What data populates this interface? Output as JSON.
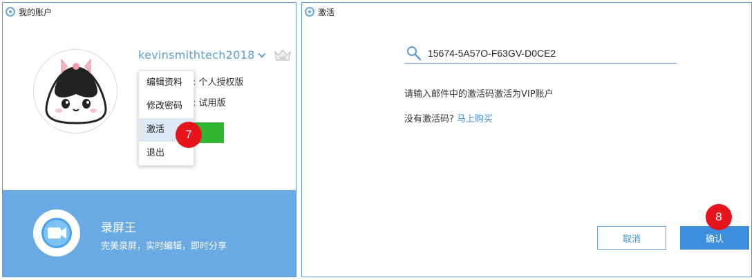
{
  "account_window": {
    "title": "我的账户",
    "username": "kevinsmithtech2018",
    "crown_icon": "vip-crown-icon",
    "crown_label": "VIP",
    "version_line": "本: 个人授权版",
    "type_line": "型: 试用版",
    "green_button_label": "",
    "menu": [
      {
        "label": "编辑资料"
      },
      {
        "label": "修改密码"
      },
      {
        "label": "激活"
      },
      {
        "label": "退出"
      }
    ],
    "badge_step": "7",
    "promo": {
      "title": "录屏王",
      "subtitle": "完美录屏，实时编辑，即时分享"
    }
  },
  "activate_window": {
    "title": "激活",
    "code_value": "15674-5A57O-F63GV-D0CE2",
    "hint": "请输入邮件中的激活码激活为VIP账户",
    "no_code": "没有激活码?",
    "buy_link": "马上购买",
    "cancel_label": "取消",
    "confirm_label": "确认",
    "badge_step": "8"
  },
  "colors": {
    "accent": "#5b9bd5",
    "promo_bg": "#69a9e4",
    "confirm": "#3c8fde",
    "badge": "#e8141b",
    "green": "#2fb52f"
  }
}
